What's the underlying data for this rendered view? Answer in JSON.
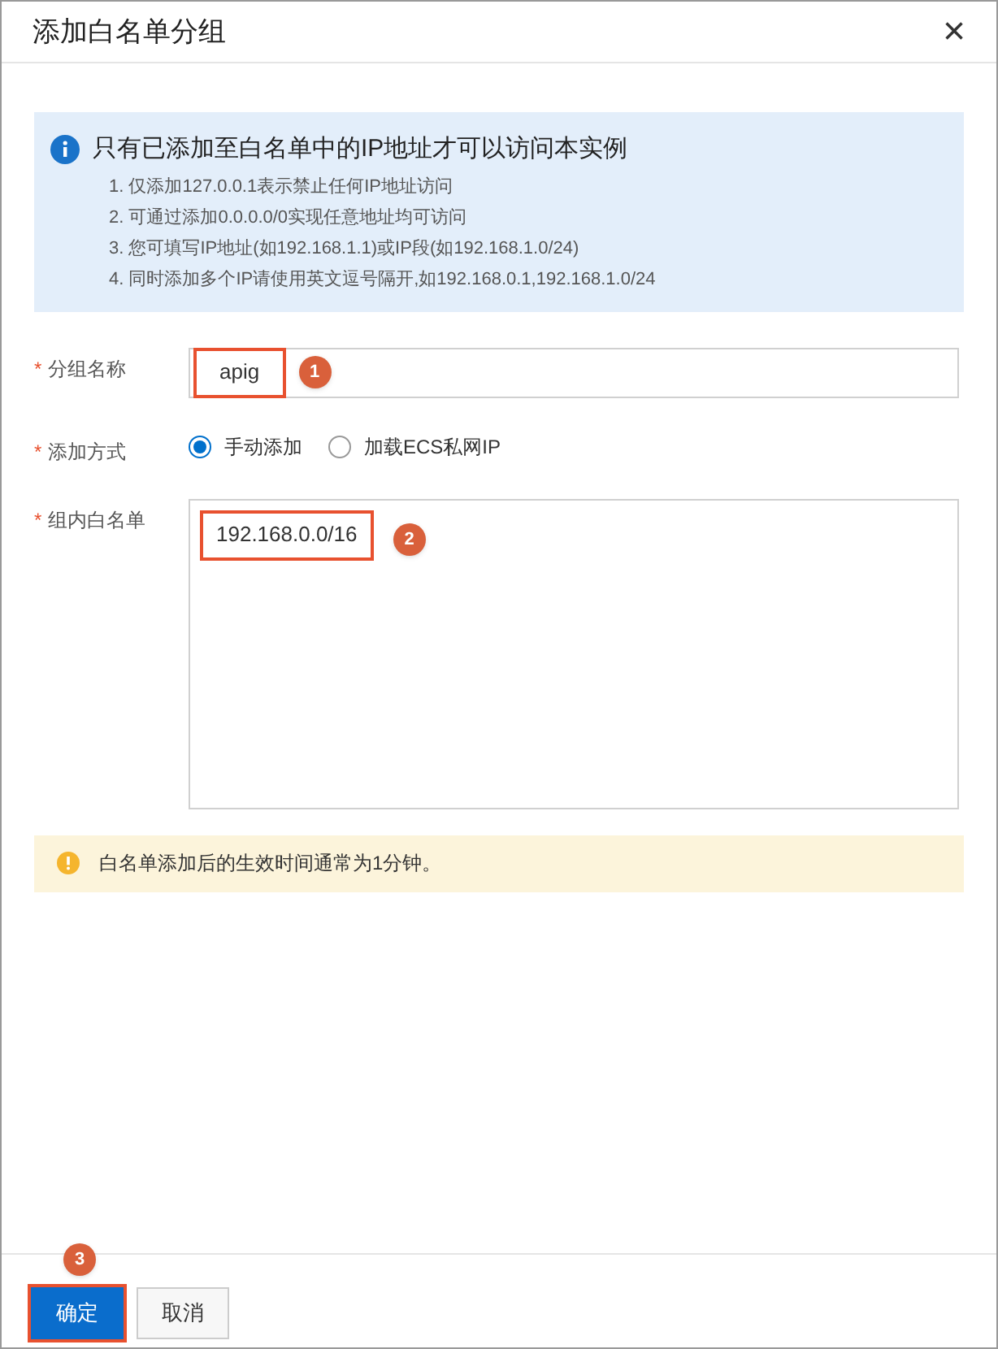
{
  "dialog": {
    "title": "添加白名单分组",
    "close": "×"
  },
  "info": {
    "heading": "只有已添加至白名单中的IP地址才可以访问本实例",
    "items": [
      "1. 仅添加127.0.0.1表示禁止任何IP地址访问",
      "2. 可通过添加0.0.0.0/0实现任意地址均可访问",
      "3. 您可填写IP地址(如192.168.1.1)或IP段(如192.168.1.0/24)",
      "4. 同时添加多个IP请使用英文逗号隔开,如192.168.0.1,192.168.1.0/24"
    ]
  },
  "fields": [
    {
      "kind": "input",
      "mark": "*",
      "label": "分组名称",
      "value": "apig",
      "highlighted": true,
      "step": "1"
    },
    {
      "kind": "radio",
      "mark": "*",
      "label": "添加方式",
      "options": [
        {
          "label": "手动添加",
          "selected": true
        },
        {
          "label": "加载ECS私网IP",
          "selected": false
        }
      ]
    },
    {
      "kind": "textarea",
      "mark": "*",
      "label": "组内白名单",
      "value": "192.168.0.0/16",
      "highlighted": true,
      "step": "2"
    }
  ],
  "notice": "白名单添加后的生效时间通常为1分钟。",
  "buttons": [
    {
      "label": "确定",
      "kind": "primary",
      "highlighted": true,
      "step": "3"
    },
    {
      "label": "取消",
      "kind": "secondary",
      "highlighted": false
    }
  ]
}
